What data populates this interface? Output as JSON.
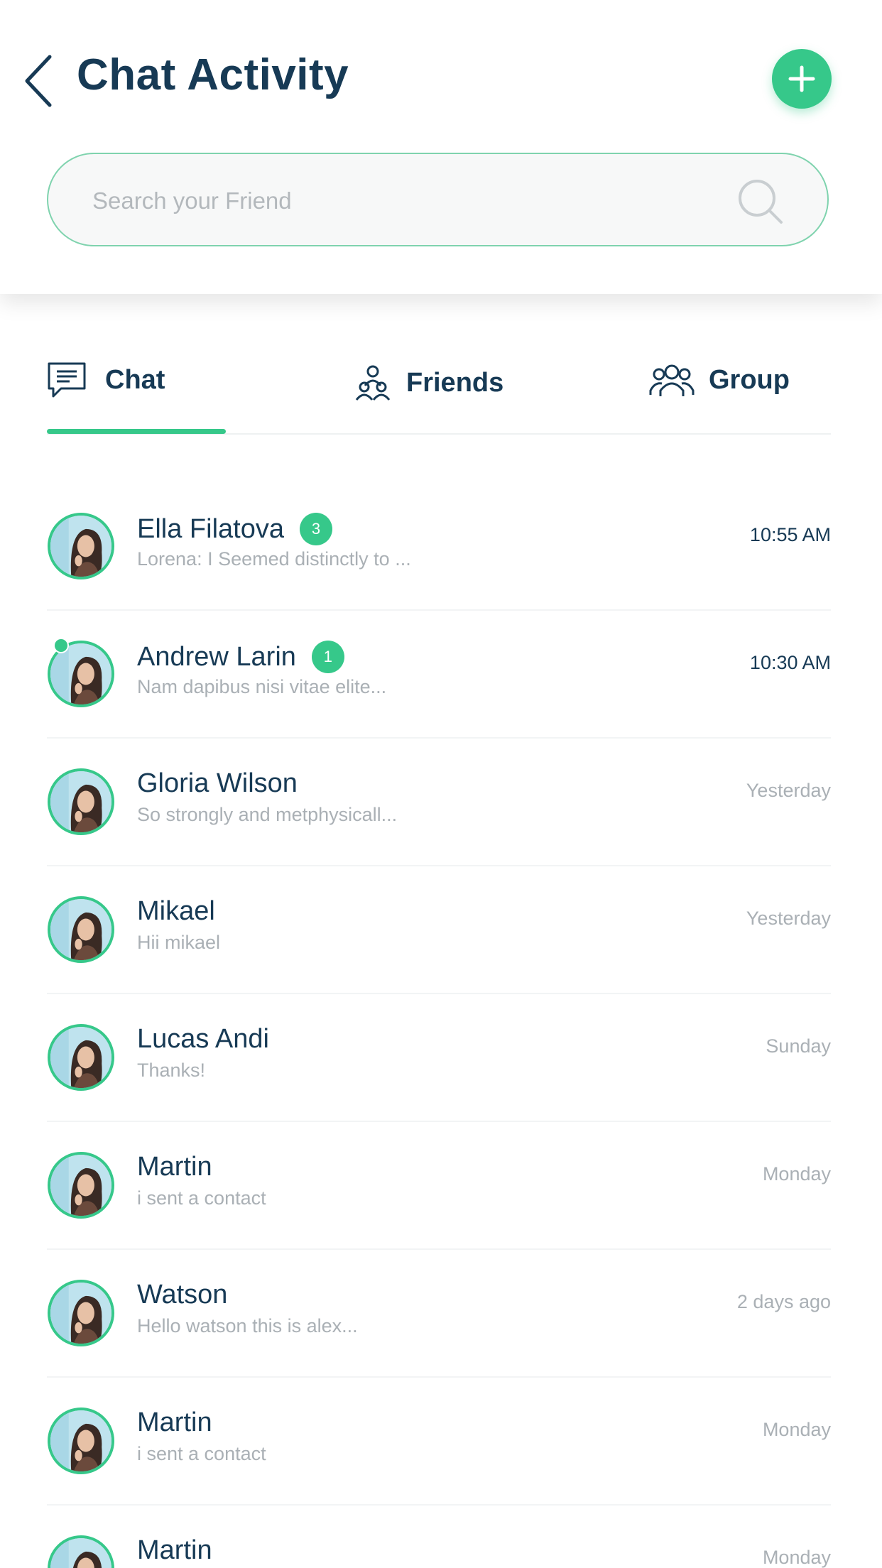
{
  "header": {
    "title": "Chat Activity",
    "back_icon": "chevron-left-icon",
    "add_icon": "plus-icon"
  },
  "search": {
    "placeholder": "Search your Friend",
    "value": "",
    "icon": "search-icon"
  },
  "tabs": [
    {
      "label": "Chat",
      "icon": "chat-bubble-icon",
      "active": true
    },
    {
      "label": "Friends",
      "icon": "friends-icon",
      "active": false
    },
    {
      "label": "Group",
      "icon": "group-icon",
      "active": false
    }
  ],
  "colors": {
    "accent": "#36c88a",
    "title": "#173a55",
    "muted": "#aab0b5"
  },
  "chats": [
    {
      "name": "Ella Filatova",
      "preview": "Lorena: I Seemed distinctly to ...",
      "time": "10:55 AM",
      "unread": "3"
    },
    {
      "name": "Andrew Larin",
      "preview": "Nam dapibus nisi vitae elite...",
      "time": "10:30 AM",
      "unread": "1",
      "online": true
    },
    {
      "name": "Gloria Wilson",
      "preview": "So strongly and metphysicall...",
      "time": "Yesterday"
    },
    {
      "name": "Mikael",
      "preview": "Hii mikael",
      "time": "Yesterday"
    },
    {
      "name": "Lucas Andi",
      "preview": "Thanks!",
      "time": "Sunday"
    },
    {
      "name": "Martin",
      "preview": "i sent a contact",
      "time": "Monday"
    },
    {
      "name": "Watson",
      "preview": "Hello watson this is alex...",
      "time": "2 days ago"
    },
    {
      "name": "Martin",
      "preview": "i sent a contact",
      "time": "Monday"
    },
    {
      "name": "Martin",
      "preview": "",
      "time": "Monday"
    }
  ]
}
